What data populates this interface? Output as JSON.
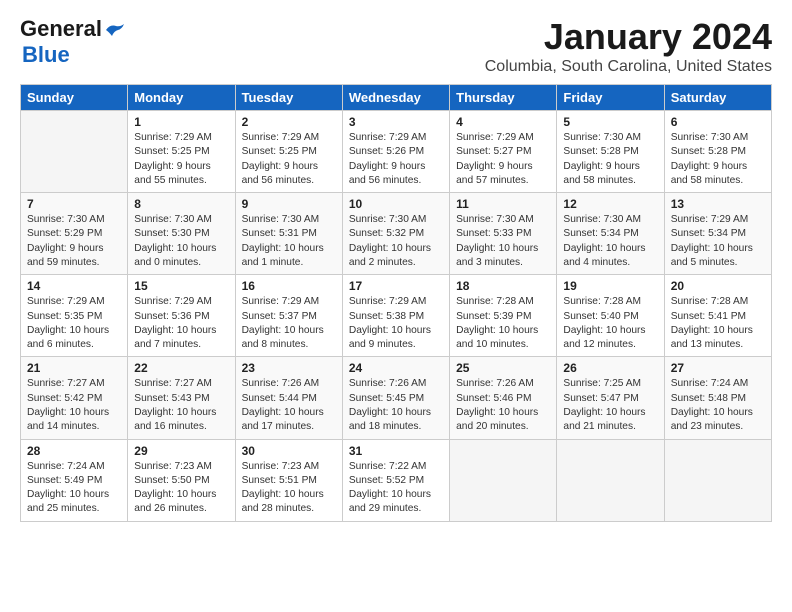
{
  "header": {
    "logo_line1": "General",
    "logo_line2": "Blue",
    "title": "January 2024",
    "subtitle": "Columbia, South Carolina, United States"
  },
  "days_of_week": [
    "Sunday",
    "Monday",
    "Tuesday",
    "Wednesday",
    "Thursday",
    "Friday",
    "Saturday"
  ],
  "weeks": [
    [
      {
        "day": "",
        "sunrise": "",
        "sunset": "",
        "daylight": ""
      },
      {
        "day": "1",
        "sunrise": "Sunrise: 7:29 AM",
        "sunset": "Sunset: 5:25 PM",
        "daylight": "Daylight: 9 hours and 55 minutes."
      },
      {
        "day": "2",
        "sunrise": "Sunrise: 7:29 AM",
        "sunset": "Sunset: 5:25 PM",
        "daylight": "Daylight: 9 hours and 56 minutes."
      },
      {
        "day": "3",
        "sunrise": "Sunrise: 7:29 AM",
        "sunset": "Sunset: 5:26 PM",
        "daylight": "Daylight: 9 hours and 56 minutes."
      },
      {
        "day": "4",
        "sunrise": "Sunrise: 7:29 AM",
        "sunset": "Sunset: 5:27 PM",
        "daylight": "Daylight: 9 hours and 57 minutes."
      },
      {
        "day": "5",
        "sunrise": "Sunrise: 7:30 AM",
        "sunset": "Sunset: 5:28 PM",
        "daylight": "Daylight: 9 hours and 58 minutes."
      },
      {
        "day": "6",
        "sunrise": "Sunrise: 7:30 AM",
        "sunset": "Sunset: 5:28 PM",
        "daylight": "Daylight: 9 hours and 58 minutes."
      }
    ],
    [
      {
        "day": "7",
        "sunrise": "Sunrise: 7:30 AM",
        "sunset": "Sunset: 5:29 PM",
        "daylight": "Daylight: 9 hours and 59 minutes."
      },
      {
        "day": "8",
        "sunrise": "Sunrise: 7:30 AM",
        "sunset": "Sunset: 5:30 PM",
        "daylight": "Daylight: 10 hours and 0 minutes."
      },
      {
        "day": "9",
        "sunrise": "Sunrise: 7:30 AM",
        "sunset": "Sunset: 5:31 PM",
        "daylight": "Daylight: 10 hours and 1 minute."
      },
      {
        "day": "10",
        "sunrise": "Sunrise: 7:30 AM",
        "sunset": "Sunset: 5:32 PM",
        "daylight": "Daylight: 10 hours and 2 minutes."
      },
      {
        "day": "11",
        "sunrise": "Sunrise: 7:30 AM",
        "sunset": "Sunset: 5:33 PM",
        "daylight": "Daylight: 10 hours and 3 minutes."
      },
      {
        "day": "12",
        "sunrise": "Sunrise: 7:30 AM",
        "sunset": "Sunset: 5:34 PM",
        "daylight": "Daylight: 10 hours and 4 minutes."
      },
      {
        "day": "13",
        "sunrise": "Sunrise: 7:29 AM",
        "sunset": "Sunset: 5:34 PM",
        "daylight": "Daylight: 10 hours and 5 minutes."
      }
    ],
    [
      {
        "day": "14",
        "sunrise": "Sunrise: 7:29 AM",
        "sunset": "Sunset: 5:35 PM",
        "daylight": "Daylight: 10 hours and 6 minutes."
      },
      {
        "day": "15",
        "sunrise": "Sunrise: 7:29 AM",
        "sunset": "Sunset: 5:36 PM",
        "daylight": "Daylight: 10 hours and 7 minutes."
      },
      {
        "day": "16",
        "sunrise": "Sunrise: 7:29 AM",
        "sunset": "Sunset: 5:37 PM",
        "daylight": "Daylight: 10 hours and 8 minutes."
      },
      {
        "day": "17",
        "sunrise": "Sunrise: 7:29 AM",
        "sunset": "Sunset: 5:38 PM",
        "daylight": "Daylight: 10 hours and 9 minutes."
      },
      {
        "day": "18",
        "sunrise": "Sunrise: 7:28 AM",
        "sunset": "Sunset: 5:39 PM",
        "daylight": "Daylight: 10 hours and 10 minutes."
      },
      {
        "day": "19",
        "sunrise": "Sunrise: 7:28 AM",
        "sunset": "Sunset: 5:40 PM",
        "daylight": "Daylight: 10 hours and 12 minutes."
      },
      {
        "day": "20",
        "sunrise": "Sunrise: 7:28 AM",
        "sunset": "Sunset: 5:41 PM",
        "daylight": "Daylight: 10 hours and 13 minutes."
      }
    ],
    [
      {
        "day": "21",
        "sunrise": "Sunrise: 7:27 AM",
        "sunset": "Sunset: 5:42 PM",
        "daylight": "Daylight: 10 hours and 14 minutes."
      },
      {
        "day": "22",
        "sunrise": "Sunrise: 7:27 AM",
        "sunset": "Sunset: 5:43 PM",
        "daylight": "Daylight: 10 hours and 16 minutes."
      },
      {
        "day": "23",
        "sunrise": "Sunrise: 7:26 AM",
        "sunset": "Sunset: 5:44 PM",
        "daylight": "Daylight: 10 hours and 17 minutes."
      },
      {
        "day": "24",
        "sunrise": "Sunrise: 7:26 AM",
        "sunset": "Sunset: 5:45 PM",
        "daylight": "Daylight: 10 hours and 18 minutes."
      },
      {
        "day": "25",
        "sunrise": "Sunrise: 7:26 AM",
        "sunset": "Sunset: 5:46 PM",
        "daylight": "Daylight: 10 hours and 20 minutes."
      },
      {
        "day": "26",
        "sunrise": "Sunrise: 7:25 AM",
        "sunset": "Sunset: 5:47 PM",
        "daylight": "Daylight: 10 hours and 21 minutes."
      },
      {
        "day": "27",
        "sunrise": "Sunrise: 7:24 AM",
        "sunset": "Sunset: 5:48 PM",
        "daylight": "Daylight: 10 hours and 23 minutes."
      }
    ],
    [
      {
        "day": "28",
        "sunrise": "Sunrise: 7:24 AM",
        "sunset": "Sunset: 5:49 PM",
        "daylight": "Daylight: 10 hours and 25 minutes."
      },
      {
        "day": "29",
        "sunrise": "Sunrise: 7:23 AM",
        "sunset": "Sunset: 5:50 PM",
        "daylight": "Daylight: 10 hours and 26 minutes."
      },
      {
        "day": "30",
        "sunrise": "Sunrise: 7:23 AM",
        "sunset": "Sunset: 5:51 PM",
        "daylight": "Daylight: 10 hours and 28 minutes."
      },
      {
        "day": "31",
        "sunrise": "Sunrise: 7:22 AM",
        "sunset": "Sunset: 5:52 PM",
        "daylight": "Daylight: 10 hours and 29 minutes."
      },
      {
        "day": "",
        "sunrise": "",
        "sunset": "",
        "daylight": ""
      },
      {
        "day": "",
        "sunrise": "",
        "sunset": "",
        "daylight": ""
      },
      {
        "day": "",
        "sunrise": "",
        "sunset": "",
        "daylight": ""
      }
    ]
  ]
}
